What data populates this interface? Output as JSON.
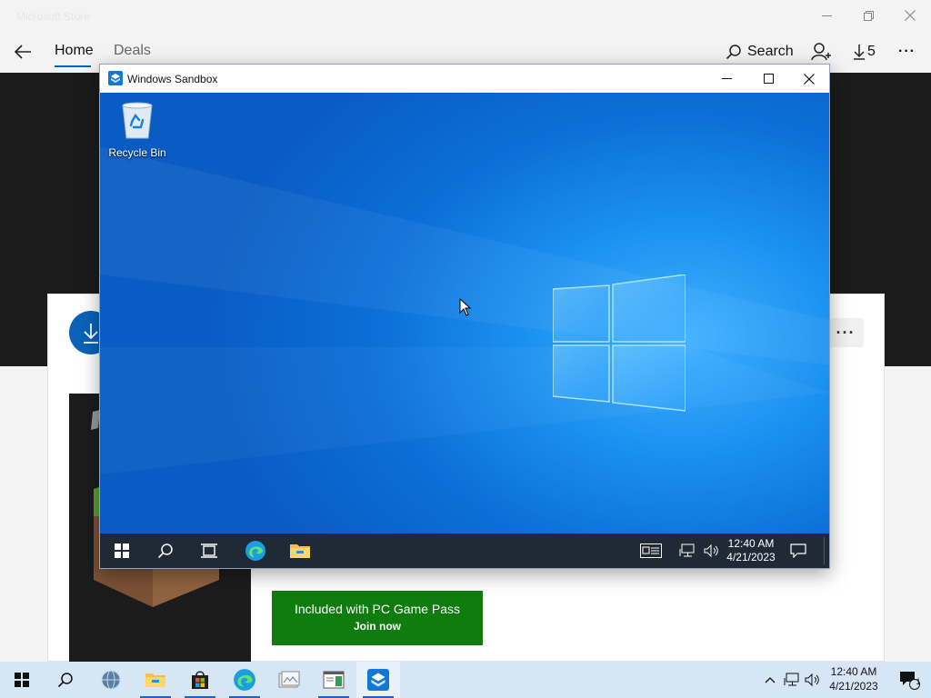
{
  "store": {
    "title": "Microsoft Store",
    "nav": {
      "tabs": [
        {
          "label": "Home",
          "selected": true
        },
        {
          "label": "Deals",
          "selected": false
        }
      ],
      "search_label": "Search",
      "downloads_count": "5",
      "more_label": "···"
    },
    "card": {
      "more_label": "···",
      "gamepass_title": "Included with PC Game Pass",
      "gamepass_sub": "Join now"
    }
  },
  "sandbox": {
    "title": "Windows Sandbox",
    "desktop": {
      "icons": [
        {
          "label": "Recycle Bin",
          "icon": "recycle-bin-icon"
        }
      ]
    },
    "taskbar": {
      "items": [
        "start-icon",
        "search-icon",
        "task-view-icon",
        "edge-icon",
        "file-explorer-icon"
      ],
      "time": "12:40 AM",
      "date": "4/21/2023"
    }
  },
  "host_taskbar": {
    "items": [
      {
        "icon": "start-icon"
      },
      {
        "icon": "search-icon"
      },
      {
        "icon": "network-globe-icon"
      },
      {
        "icon": "file-explorer-icon",
        "running": true
      },
      {
        "icon": "microsoft-store-icon",
        "running": true
      },
      {
        "icon": "edge-icon",
        "running": true
      },
      {
        "icon": "image-viewer-icon"
      },
      {
        "icon": "window-app-icon",
        "running": true
      },
      {
        "icon": "windows-sandbox-icon",
        "running": true,
        "active": true
      }
    ],
    "time": "12:40 AM",
    "date": "4/21/2023",
    "notification_count": "1"
  },
  "colors": {
    "accent": "#0067c0",
    "gamepass_green": "#107c10",
    "sandbox_taskbar": "#1f2a36",
    "host_taskbar": "#d6e6f5"
  }
}
